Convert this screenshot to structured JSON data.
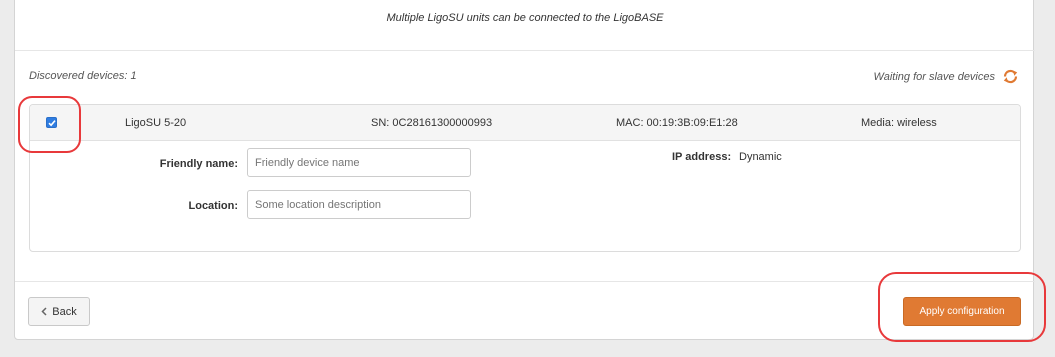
{
  "info_message": "Multiple LigoSU units can be connected to the LigoBASE",
  "discovered_label": "Discovered devices: 1",
  "waiting_label": "Waiting for slave devices",
  "device": {
    "checked": true,
    "model": "LigoSU 5-20",
    "serial": "SN: 0C28161300000993",
    "mac": "MAC: 00:19:3B:09:E1:28",
    "media": "Media: wireless",
    "friendly_name_label": "Friendly name:",
    "friendly_name_placeholder": "Friendly device name",
    "location_label": "Location:",
    "location_placeholder": "Some location description",
    "ip_label": "IP address:",
    "ip_value": "Dynamic"
  },
  "buttons": {
    "back": "Back",
    "apply": "Apply configuration"
  },
  "colors": {
    "accent": "#e07a33",
    "checkbox": "#2f7de1",
    "highlight": "#e8393b"
  },
  "icons": {
    "refresh": "refresh-icon",
    "back": "chevron-left-icon",
    "check": "check-icon"
  }
}
